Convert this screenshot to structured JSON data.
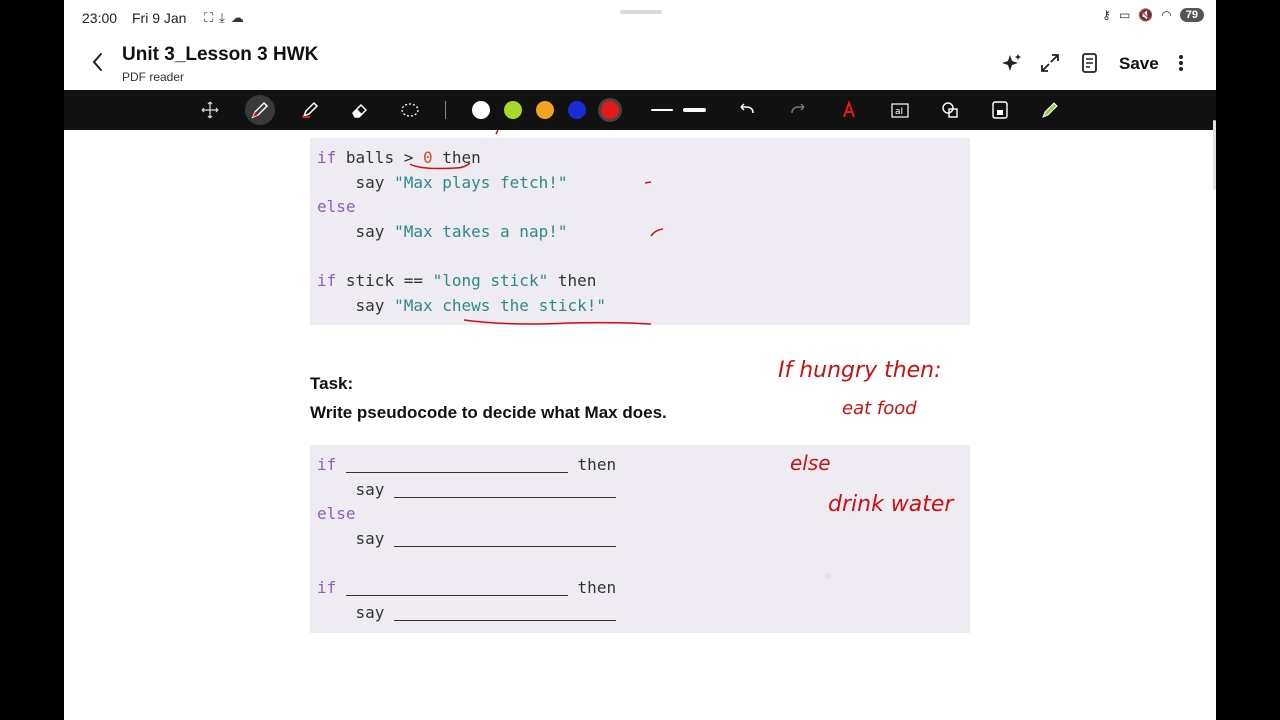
{
  "status": {
    "time": "23:00",
    "date": "Fri 9 Jan",
    "battery": "79"
  },
  "header": {
    "title": "Unit 3_Lesson 3 HWK",
    "subtitle": "PDF reader",
    "save_label": "Save"
  },
  "toolbar": {
    "colors": [
      "#ffffff",
      "#a8d928",
      "#f2a321",
      "#1b2bd8",
      "#e21a1a"
    ],
    "selected_color": "#e21a1a"
  },
  "code_top": {
    "lines": [
      {
        "kw": "if",
        "text": "balls > 0 then"
      },
      {
        "say": "say",
        "str": "\"Max plays fetch!\""
      },
      {
        "kw": "else"
      },
      {
        "say": "say",
        "str": "\"Max takes a nap!\""
      },
      {
        "kw": "if",
        "text": "stick == \"long stick\" then"
      },
      {
        "say": "say",
        "str": "\"Max chews the stick!\""
      }
    ],
    "balls": "balls",
    "gt": " > ",
    "zero": "0",
    "then": " then",
    "stick_pre": "stick == ",
    "stick_str": "\"long stick\""
  },
  "task": {
    "heading": "Task:",
    "description": "Write pseudocode to decide what Max does."
  },
  "code_task": {
    "if": "if",
    "then": "then",
    "say": "say",
    "else": "else"
  },
  "handwriting": {
    "line1": "If  hungry  then:",
    "line2": "eat  food",
    "line3": "else",
    "line4": "drink  water"
  }
}
